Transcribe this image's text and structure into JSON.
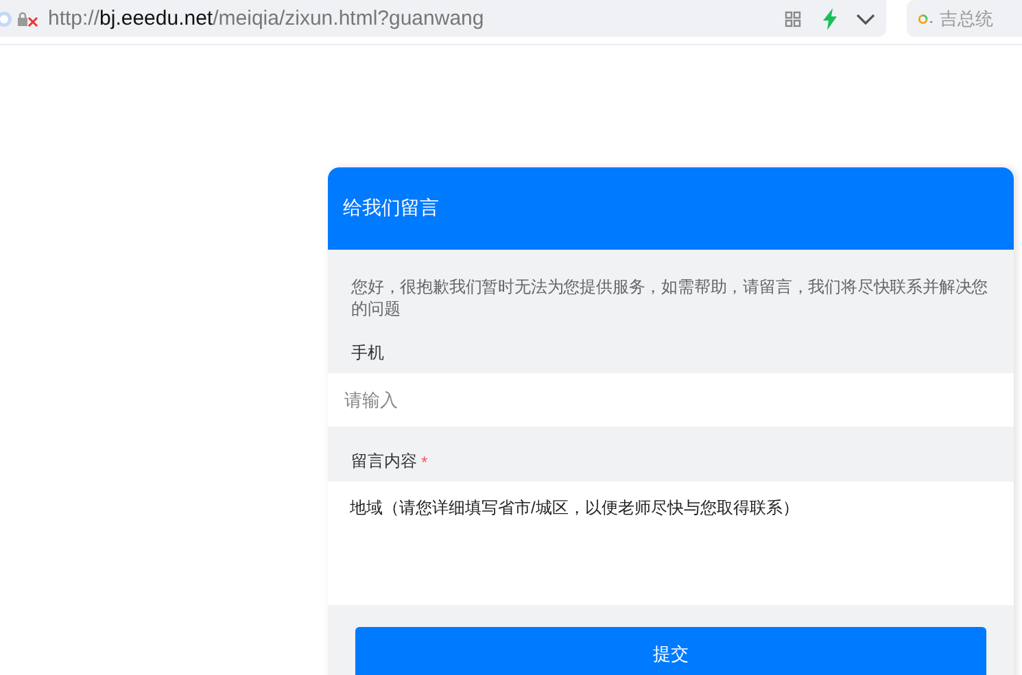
{
  "address_bar": {
    "scheme": "http://",
    "host": "bj.eeedu.net",
    "path": "/meiqia/zixun.html?guanwang",
    "insecure": true
  },
  "search_box": {
    "placeholder": "吉总统"
  },
  "message_form": {
    "title": "给我们留言",
    "intro": "您好，很抱歉我们暂时无法为您提供服务，如需帮助，请留言，我们将尽快联系并解决您的问题",
    "required_mark": "*",
    "fields": [
      {
        "kind": "input",
        "label": "手机",
        "required": false,
        "placeholder": "请输入"
      },
      {
        "kind": "textarea",
        "label": "留言内容",
        "required": true,
        "value": "地域（请您详细填写省市/城区，以便老师尽快与您取得联系）"
      }
    ],
    "submit": "提交"
  }
}
